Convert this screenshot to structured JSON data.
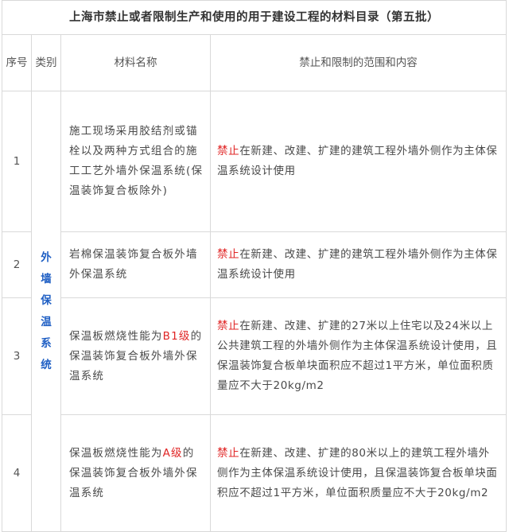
{
  "table": {
    "title": "上海市禁止或者限制生产和使用的用于建设工程的材料目录（第五批）",
    "headers": {
      "no": "序号",
      "category": "类别",
      "material": "材料名称",
      "scope": "禁止和限制的范围和内容"
    },
    "category": "外墙保温系统",
    "rows": [
      {
        "no": "1",
        "material": "施工现场采用胶结剂或锚栓以及两种方式组合的施工工艺外墙外保温系统(保温装饰复合板除外)",
        "scope_prefix": "禁止",
        "scope_text": "在新建、改建、扩建的建筑工程外墙外侧作为主体保温系统设计使用"
      },
      {
        "no": "2",
        "material": "岩棉保温装饰复合板外墙外保温系统",
        "scope_prefix": "禁止",
        "scope_text": "在新建、改建、扩建的建筑工程外墙外侧作为主体保温系统设计使用"
      },
      {
        "no": "3",
        "material_pre": "保温板燃烧性能为",
        "material_grade": "B1级",
        "material_post": "的保温装饰复合板外墙外保温系统",
        "scope_prefix": "禁止",
        "scope_text": "在新建、改建、扩建的27米以上住宅以及24米以上公共建筑工程的外墙外侧作为主体保温系统设计使用，且保温装饰复合板单块面积应不超过1平方米，单位面积质量应不大于20kg/m2"
      },
      {
        "no": "4",
        "material_pre": "保温板燃烧性能为",
        "material_grade": "A级",
        "material_post": "的保温装饰复合板外墙外保温系统",
        "scope_prefix": "禁止",
        "scope_text": "在新建、改建、扩建的80米以上的建筑工程外墙外侧作为主体保温系统设计使用，且保温装饰复合板单块面积应不超过1平方米，单位面积质量应不大于20kg/m2"
      }
    ]
  }
}
